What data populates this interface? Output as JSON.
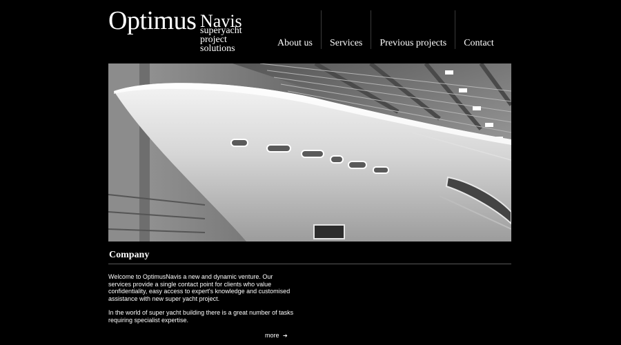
{
  "brand": {
    "name_main": "Optimus",
    "name_suffix": "Navis",
    "tagline": [
      "superyacht",
      "project",
      "solutions"
    ]
  },
  "nav": {
    "items": [
      "About us",
      "Services",
      "Previous projects",
      "Contact"
    ]
  },
  "content": {
    "title": "Company",
    "paragraphs": [
      "Welcome to OptimusNavis a new and dynamic venture. Our services provide a single contact point for clients who value confidentiality, easy access to expert's knowledge and customised assistance with new super yacht project.",
      "In the world of super yacht building there is a great number of tasks requiring specialist expertise."
    ],
    "more_label": "more",
    "more_icon": "arrow-right-icon"
  },
  "colors": {
    "background": "#000000",
    "text": "#ffffff",
    "divider": "#5a5a5a"
  }
}
